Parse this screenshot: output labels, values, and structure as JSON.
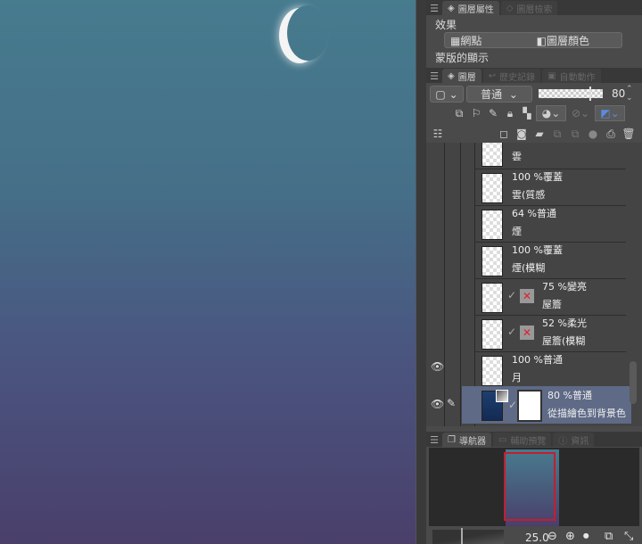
{
  "tabs_top": {
    "active": "圖層屬性",
    "other": "圖層檢索"
  },
  "effects": {
    "heading": "效果",
    "halftone": "網點",
    "layer_color": "圖層顏色",
    "mask_display": "蒙版的顯示"
  },
  "tabs_layer": {
    "active": "圖層",
    "history": "歷史記錄",
    "auto_action": "自動動作"
  },
  "layer_toolbar": {
    "blend_mode": "普通",
    "opacity": "80",
    "opacity_fraction": 0.8
  },
  "layers": [
    {
      "line1": "",
      "line2": "雲"
    },
    {
      "line1": "100 %覆蓋",
      "line2": "雲(質感"
    },
    {
      "line1": "64 %普通",
      "line2": "煙"
    },
    {
      "line1": "100 %覆蓋",
      "line2": "煙(模糊"
    },
    {
      "line1": "75 %變亮",
      "line2": "屋簷"
    },
    {
      "line1": "52 %柔光",
      "line2": "屋簷(模糊"
    },
    {
      "line1": "100 %普通",
      "line2": "月"
    },
    {
      "line1": "80 %普通",
      "line2": "從描繪色到背景色"
    }
  ],
  "tabs_nav": {
    "active": "導航器",
    "sub_view": "輔助預覽",
    "info": "資訊"
  },
  "navigator": {
    "zoom": "25.0"
  },
  "colors": {
    "accent_red": "#cc2233",
    "selected_layer": "#5e6a86"
  }
}
